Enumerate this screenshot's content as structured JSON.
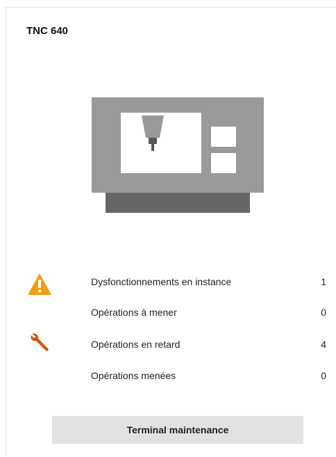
{
  "card": {
    "title": "TNC 640"
  },
  "machine_illustration": {
    "icon": "cnc-machine-icon",
    "colors": {
      "body": "#999999",
      "base": "#666666",
      "window": "#ffffff"
    }
  },
  "stats": [
    {
      "label": "Dysfonctionnements en instance",
      "value": "1",
      "icon": "warning-icon",
      "icon_color": "#f39c12"
    },
    {
      "label": "Opérations à mener",
      "value": "0"
    },
    {
      "label": "Opérations en retard",
      "value": "4",
      "icon": "wrench-icon",
      "icon_color": "#d35400"
    },
    {
      "label": "Opérations menées",
      "value": "0"
    }
  ],
  "actions": {
    "terminal_label": "Terminal maintenance"
  }
}
